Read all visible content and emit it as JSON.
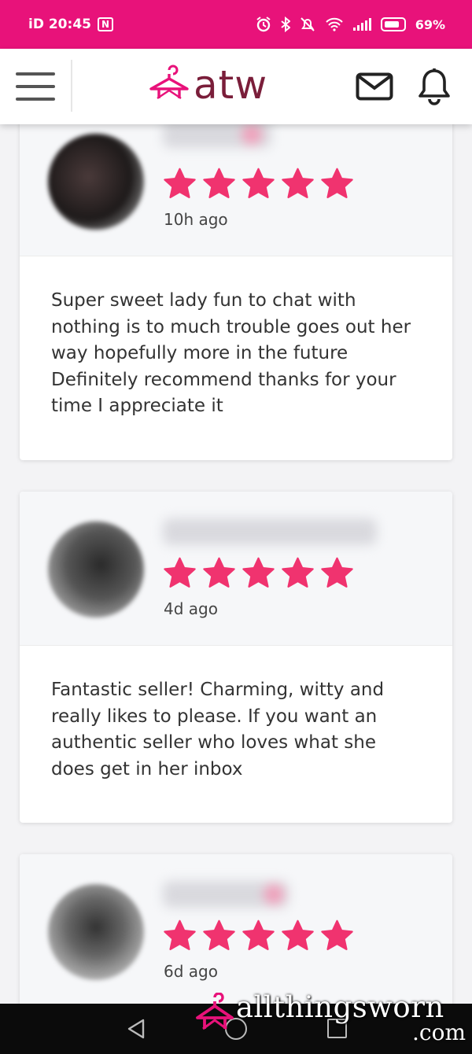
{
  "status_bar": {
    "time": "iD 20:45",
    "nfc_label": "N",
    "battery": "69%",
    "icons": [
      "alarm-icon",
      "bluetooth-icon",
      "mute-icon",
      "wifi-icon",
      "signal-icon",
      "battery-icon"
    ]
  },
  "header": {
    "logo_text": "atw",
    "icons": [
      "menu-icon",
      "hanger-logo-icon",
      "mail-icon",
      "bell-icon"
    ]
  },
  "colors": {
    "brand_pink": "#e8127a",
    "star_pink": "#f0336f",
    "logo_maroon": "#7a1e3a"
  },
  "reviews": [
    {
      "rating": 5,
      "time_ago": "10h ago",
      "text": "Super sweet lady fun to chat with nothing is to much trouble goes out her way hopefully more in the future Definitely recommend thanks for your time I appreciate it"
    },
    {
      "rating": 5,
      "time_ago": "4d ago",
      "text": "Fantastic seller! Charming, witty and really likes to please. If you want an authentic seller who loves what she does get in her inbox"
    },
    {
      "rating": 5,
      "time_ago": "6d ago",
      "text": ""
    }
  ],
  "watermark": {
    "text": "allthingsworn",
    "suffix": ".com"
  },
  "nav_bar": {
    "icons": [
      "back-icon",
      "home-icon",
      "recents-icon"
    ]
  }
}
